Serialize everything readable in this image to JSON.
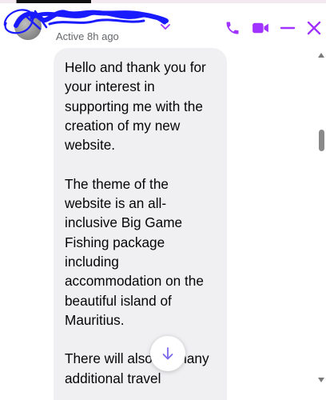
{
  "header": {
    "presence": "Active 8h ago",
    "avatar_icon": "contact-avatar",
    "name_chevron_icon": "chevron-down-icon"
  },
  "actions": {
    "call_icon": "phone-icon",
    "video_icon": "video-camera-icon",
    "minimize_icon": "minimize-icon",
    "close_icon": "close-icon",
    "accent_color": "#a033ff"
  },
  "message": {
    "paragraph_1": "Hello and thank you for your interest in supporting me with the creation of my new website.",
    "paragraph_2": "The theme of the website is an all-inclusive Big Game Fishing package including accommodation on the beautiful island of Mauritius.",
    "paragraph_3": "There will also be many additional travel",
    "bubble_color": "#f0f0f3"
  },
  "controls": {
    "scroll_down_icon": "arrow-down-icon",
    "scroll_down_color": "#7b68ee"
  }
}
